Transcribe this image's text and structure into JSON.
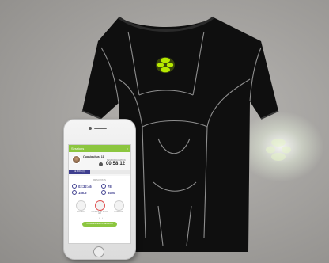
{
  "app": {
    "header_title": "Sessions",
    "header_icon": "share-icon",
    "username": "Quasiguitus_11",
    "timer_label": "SESSION DURATION",
    "timer": "00:58:12",
    "tabs": [
      "LE MOIS (1)",
      "",
      ""
    ],
    "section_title": "RESULTATS",
    "stats": [
      {
        "icon": "clock-icon",
        "value": "02:32:46"
      },
      {
        "icon": "heart-icon",
        "value": "78"
      },
      {
        "icon": "distance-icon",
        "value": "146.5"
      },
      {
        "icon": "flame-icon",
        "value": "8400"
      }
    ],
    "activities": [
      {
        "icon": "bike-icon",
        "label": "CYCLING"
      },
      {
        "icon": "run-icon",
        "label": "COURSE DE PLEIN AIR"
      },
      {
        "icon": "swim-icon",
        "label": "NATATION"
      }
    ],
    "page_dots": "• • •",
    "start_button": "COMMENCER LA SESSION"
  },
  "colors": {
    "accent_green": "#8cc63f",
    "logo_green": "#b6e800",
    "shirt_black": "#0f0f0f",
    "seam_gray": "#9a9a9a",
    "stat_blue": "#3f3f8f"
  },
  "shirt_logo_icon": "four-petal-logo-icon"
}
